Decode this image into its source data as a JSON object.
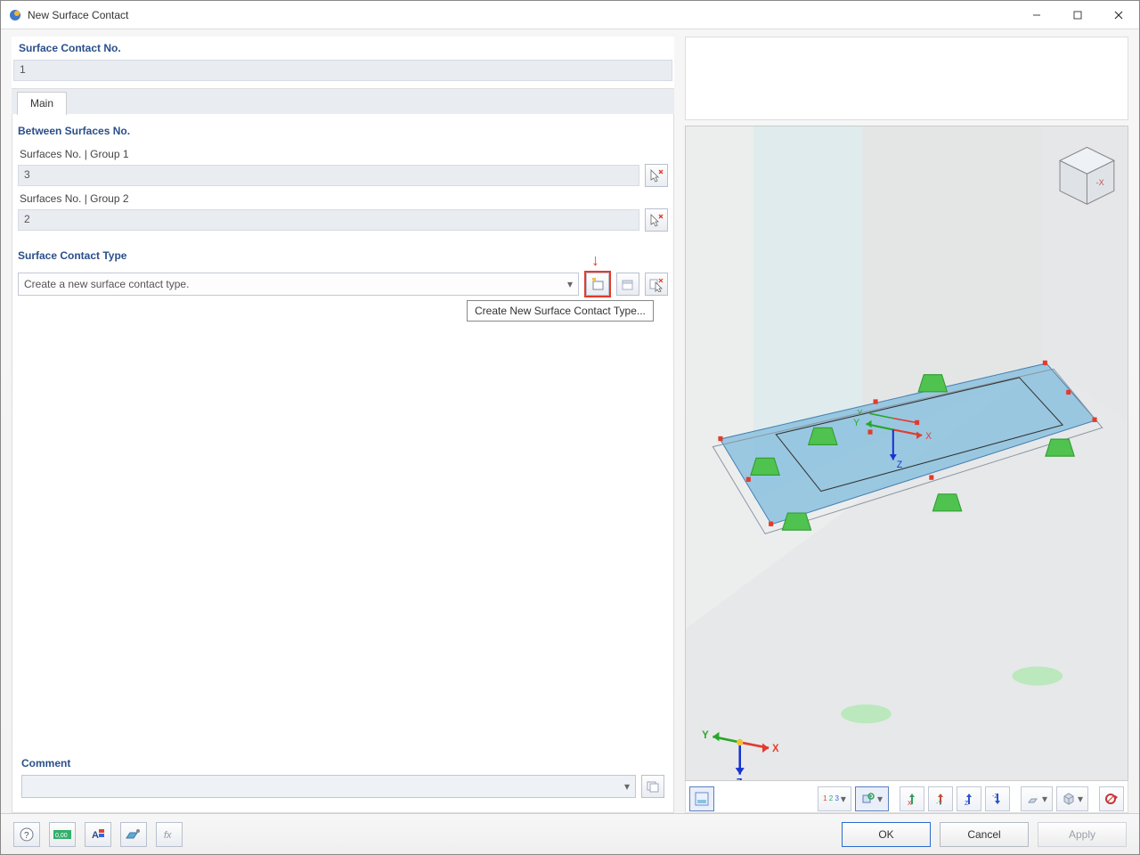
{
  "window": {
    "title": "New Surface Contact"
  },
  "header": {
    "contact_no_label": "Surface Contact No.",
    "contact_no_value": "1"
  },
  "tabs": {
    "main": "Main"
  },
  "between": {
    "section": "Between Surfaces No.",
    "group1_label": "Surfaces No. | Group 1",
    "group1_value": "3",
    "group2_label": "Surfaces No. | Group 2",
    "group2_value": "2"
  },
  "contact_type": {
    "section": "Surface Contact Type",
    "placeholder": "Create a new surface contact type.",
    "tooltip": "Create New Surface Contact Type..."
  },
  "comment": {
    "section": "Comment",
    "value": ""
  },
  "axis_overlay": {
    "x": "X",
    "y": "Y",
    "z": "Z",
    "y2": "Y",
    "x2": "X",
    "z2": "Z"
  },
  "footer": {
    "ok": "OK",
    "cancel": "Cancel",
    "apply": "Apply"
  },
  "icons": {
    "new": "new-icon",
    "edit": "edit-icon",
    "pick": "picker-icon"
  }
}
